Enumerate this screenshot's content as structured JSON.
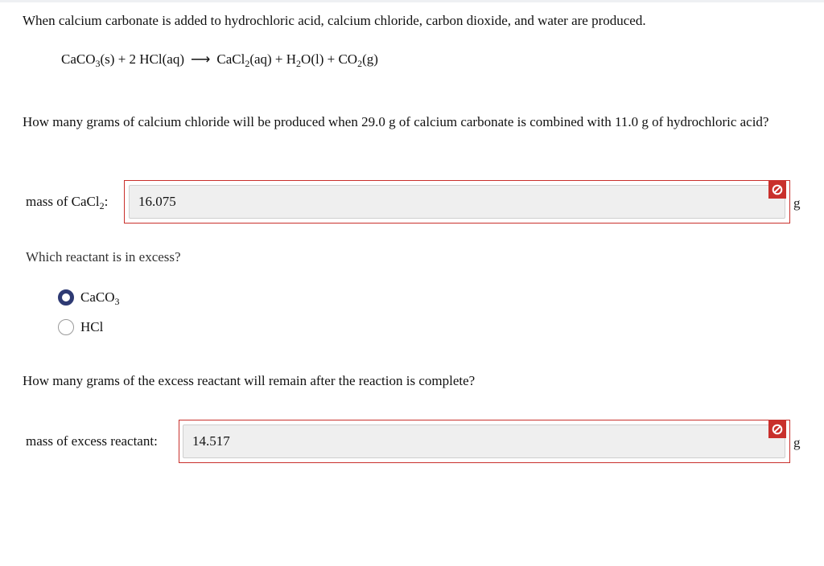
{
  "intro_text": "When calcium carbonate is added to hydrochloric acid, calcium chloride, carbon dioxide, and water are produced.",
  "equation": {
    "r1": "CaCO",
    "r1_sub": "3",
    "r1_state": "(s) + 2 HCl(aq)",
    "arrow": "⟶",
    "p1": "CaCl",
    "p1_sub": "2",
    "p1_state": "(aq) + H",
    "p2_sub": "2",
    "p2_state": "O(l) + CO",
    "p3_sub": "2",
    "p3_state": "(g)"
  },
  "question1": "How many grams of calcium chloride will be produced when 29.0 g of calcium carbonate is combined with 11.0 g of hydrochloric acid?",
  "answer1": {
    "label_main": "mass of CaCl",
    "label_sub": "2",
    "label_colon": ":",
    "value": "16.075",
    "unit": "g",
    "status_icon": "error-icon"
  },
  "question2": "Which reactant is in excess?",
  "options": [
    {
      "label": "CaCO",
      "sub": "3",
      "selected": true
    },
    {
      "label": "HCl",
      "sub": "",
      "selected": false
    }
  ],
  "question3": "How many grams of the excess reactant will remain after the reaction is complete?",
  "answer2": {
    "label": "mass of excess reactant:",
    "value": "14.517",
    "unit": "g",
    "status_icon": "error-icon"
  },
  "colors": {
    "error": "#c9302c",
    "radio_selected": "#2e3a73",
    "field_bg": "#efefef"
  }
}
